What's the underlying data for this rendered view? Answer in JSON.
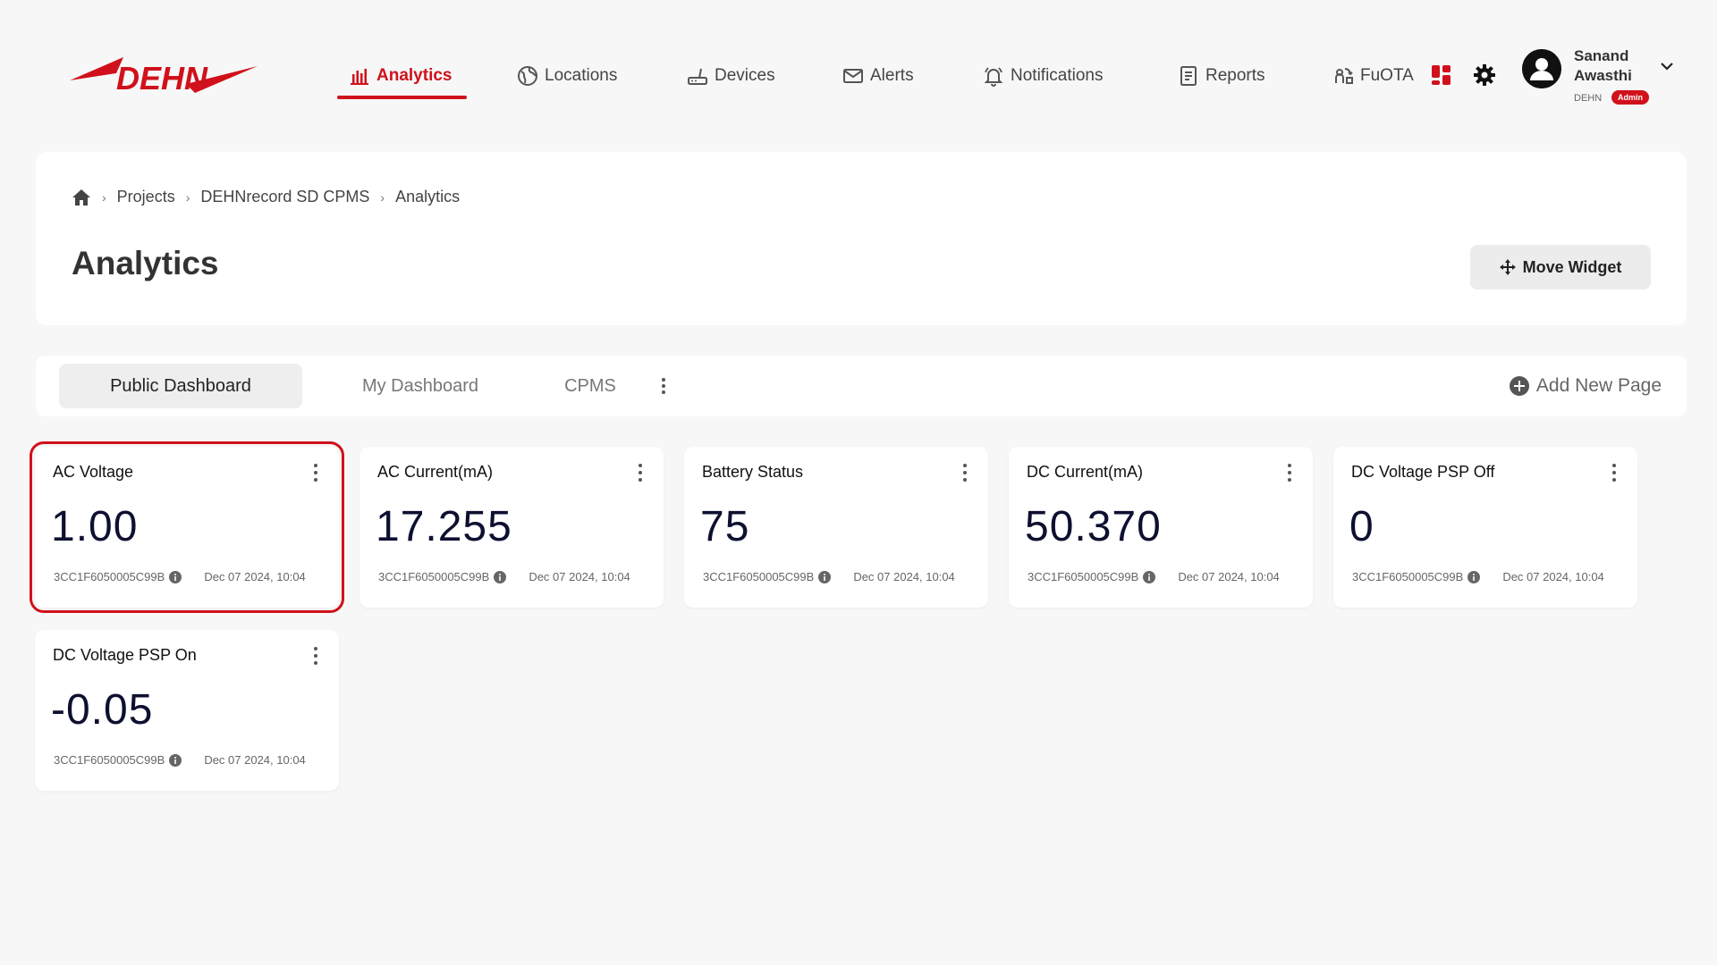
{
  "brand": {
    "logo_text": "DEHN",
    "accent": "#d0111b"
  },
  "nav": {
    "items": [
      {
        "label": "Analytics",
        "icon": "bar-chart-icon",
        "active": true
      },
      {
        "label": "Locations",
        "icon": "globe-icon"
      },
      {
        "label": "Devices",
        "icon": "router-icon"
      },
      {
        "label": "Alerts",
        "icon": "mail-icon"
      },
      {
        "label": "Notifications",
        "icon": "bell-icon"
      },
      {
        "label": "Reports",
        "icon": "report-icon"
      },
      {
        "label": "FuOTA",
        "icon": "firmware-update-icon"
      }
    ],
    "tools": [
      "apps-grid-icon",
      "gear-icon"
    ]
  },
  "user": {
    "first_name": "Sanand",
    "last_name": "Awasthi",
    "org": "DEHN",
    "role": "Admin"
  },
  "breadcrumb": [
    "Projects",
    "DEHNrecord SD CPMS",
    "Analytics"
  ],
  "page": {
    "title": "Analytics",
    "move_widget_label": "Move Widget"
  },
  "tabs": {
    "items": [
      "Public Dashboard",
      "My Dashboard",
      "CPMS"
    ],
    "active": "Public Dashboard",
    "add_label": "Add New Page"
  },
  "widgets": [
    {
      "title": "AC Voltage",
      "value": "1.00",
      "device": "3CC1F6050005C99B",
      "date": "Dec 07 2024, 10:04",
      "selected": true
    },
    {
      "title": "AC Current(mA)",
      "value": "17.255",
      "device": "3CC1F6050005C99B",
      "date": "Dec 07 2024, 10:04"
    },
    {
      "title": "Battery Status",
      "value": "75",
      "device": "3CC1F6050005C99B",
      "date": "Dec 07 2024, 10:04"
    },
    {
      "title": "DC Current(mA)",
      "value": "50.370",
      "device": "3CC1F6050005C99B",
      "date": "Dec 07 2024, 10:04"
    },
    {
      "title": "DC Voltage PSP Off",
      "value": "0",
      "device": "3CC1F6050005C99B",
      "date": "Dec 07 2024, 10:04"
    },
    {
      "title": "DC Voltage PSP On",
      "value": "-0.05",
      "device": "3CC1F6050005C99B",
      "date": "Dec 07 2024, 10:04"
    }
  ]
}
